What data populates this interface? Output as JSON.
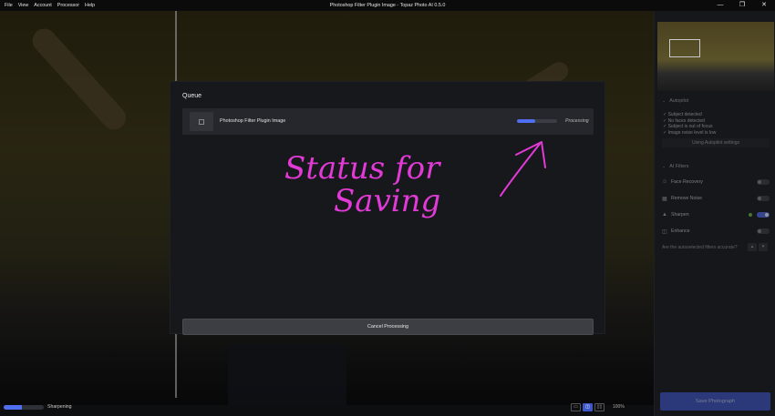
{
  "window": {
    "title": "Photoshop Filter Plugin Image - Topaz Photo AI 0.5.0",
    "menu": [
      "File",
      "View",
      "Account",
      "Processor",
      "Help"
    ],
    "controls": [
      "—",
      "❐",
      "✕"
    ]
  },
  "queue": {
    "title": "Queue",
    "item": {
      "name": "Photoshop Filter Plugin Image",
      "status": "Processing",
      "progress": 0.45
    },
    "cancel_label": "Cancel Processing"
  },
  "annotation": {
    "line1": "Status for",
    "line2": "Saving",
    "color": "#e23ad6"
  },
  "panel": {
    "autopilot": {
      "title": "Autopilot",
      "checks": [
        "✓ Subject detected",
        "✓ No faces detected",
        "✓ Subject is out of focus",
        "✓ Image noise level is low"
      ],
      "settings_label": "Using Autopilot settings"
    },
    "filters": {
      "title": "AI Filters",
      "items": [
        {
          "label": "Face Recovery",
          "icon": "face-icon",
          "on": false
        },
        {
          "label": "Remove Noise",
          "icon": "noise-icon",
          "on": false
        },
        {
          "label": "Sharpen",
          "icon": "sharpen-icon",
          "on": true
        },
        {
          "label": "Enhance",
          "icon": "enhance-icon",
          "on": false
        }
      ]
    },
    "feedback_question": "Are the autoselected filters accurate?",
    "save_label": "Save Photograph"
  },
  "bottom": {
    "status_label": "Sharpening",
    "progress": 0.45,
    "zoom": "100%"
  },
  "colors": {
    "accent": "#4f6ef0",
    "annotation": "#e23ad6"
  }
}
